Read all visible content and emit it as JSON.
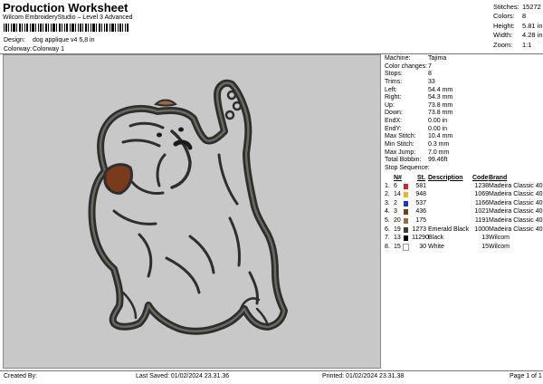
{
  "header": {
    "title": "Production Worksheet",
    "subtitle": "Wilcom EmbroideryStudio – Level 3 Advanced"
  },
  "design": {
    "label": "Design:",
    "value": "dog applique v4 5,8 in"
  },
  "colorway": {
    "label": "Colorway:",
    "value": "Colorway 1"
  },
  "stats": [
    {
      "key": "Stitches:",
      "value": "15272"
    },
    {
      "key": "Colors:",
      "value": "8"
    },
    {
      "key": "Height:",
      "value": "5.81 in"
    },
    {
      "key": "Width:",
      "value": "4.28 in"
    },
    {
      "key": "Zoom:",
      "value": "1:1"
    }
  ],
  "machine_info": [
    {
      "key": "Machine:",
      "value": "Tajima"
    },
    {
      "key": "Color changes:",
      "value": "7"
    },
    {
      "key": "Stops:",
      "value": "8"
    },
    {
      "key": "Trims:",
      "value": "33"
    },
    {
      "key": "Left:",
      "value": "54.4 mm"
    },
    {
      "key": "Right:",
      "value": "54.3 mm"
    },
    {
      "key": "Up:",
      "value": "73.8 mm"
    },
    {
      "key": "Down:",
      "value": "73.8 mm"
    },
    {
      "key": "EndX:",
      "value": "0.00 in"
    },
    {
      "key": "EndY:",
      "value": "0.00 in"
    },
    {
      "key": "Max Stitch:",
      "value": "10.4 mm"
    },
    {
      "key": "Min Stitch:",
      "value": "0.3 mm"
    },
    {
      "key": "Max Jump:",
      "value": "7.0 mm"
    },
    {
      "key": "Total Bobbin:",
      "value": "99.46ft"
    }
  ],
  "stop_sequence": {
    "title": "Stop Sequence:",
    "headers": {
      "n": "N#",
      "st": "St.",
      "description": "Description",
      "code": "Code",
      "brand": "Brand"
    },
    "rows": [
      {
        "stop": "1.",
        "n": "6",
        "color": "#d42020",
        "st": "581",
        "description": "",
        "code": "1238",
        "brand": "Madeira Classic 40"
      },
      {
        "stop": "2.",
        "n": "14",
        "color": "#e8b040",
        "st": "948",
        "description": "",
        "code": "1069",
        "brand": "Madeira Classic 40"
      },
      {
        "stop": "3.",
        "n": "2",
        "color": "#1c34c8",
        "st": "537",
        "description": "",
        "code": "1166",
        "brand": "Madeira Classic 40"
      },
      {
        "stop": "4.",
        "n": "3",
        "color": "#7a3a1c",
        "st": "436",
        "description": "",
        "code": "1021",
        "brand": "Madeira Classic 40"
      },
      {
        "stop": "5.",
        "n": "20",
        "color": "#9c6a3c",
        "st": "175",
        "description": "",
        "code": "1191",
        "brand": "Madeira Classic 40"
      },
      {
        "stop": "6.",
        "n": "19",
        "color": "#3c3c34",
        "st": "1273",
        "description": "Emerald Black",
        "code": "1000",
        "brand": "Madeira Classic 40"
      },
      {
        "stop": "7.",
        "n": "13",
        "color": "#000000",
        "st": "11290",
        "description": "Black",
        "code": "13",
        "brand": "Wilcom"
      },
      {
        "stop": "8.",
        "n": "15",
        "color": "#ffffff",
        "st": "30",
        "description": "White",
        "code": "15",
        "brand": "Wilcom"
      }
    ]
  },
  "footer": {
    "created_by": "Created By:",
    "last_saved": "Last Saved: 01/02/2024 23.31.36",
    "printed": "Printed: 01/02/2024 23.31.38",
    "page": "Page 1 of 1"
  }
}
